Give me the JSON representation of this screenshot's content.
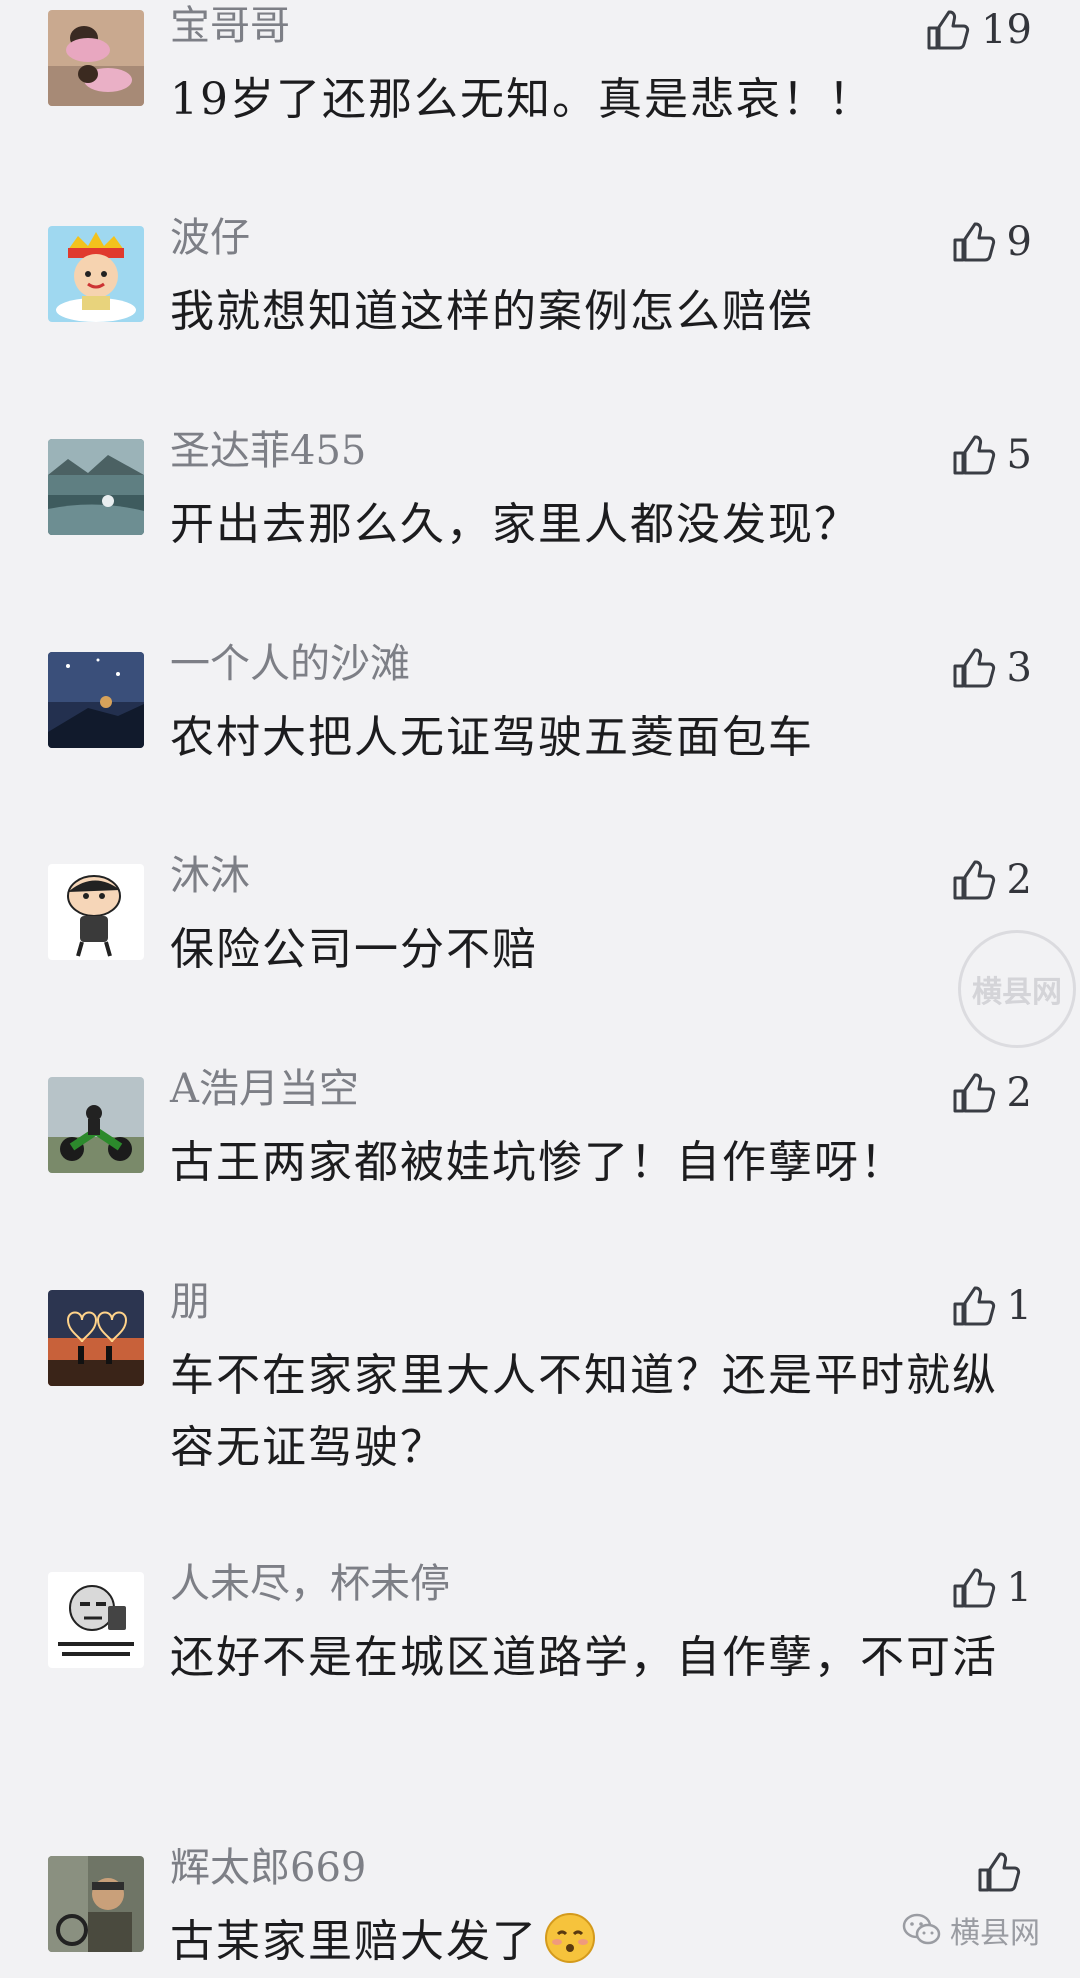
{
  "comments": [
    {
      "nickname": "宝哥哥",
      "content": "19岁了还那么无知。真是悲哀！！",
      "likes": "19",
      "avatar": "kids-photo-avatar"
    },
    {
      "nickname": "波仔",
      "content": "我就想知道这样的案例怎么赔偿",
      "likes": "9",
      "avatar": "cartoon-boy-avatar"
    },
    {
      "nickname": "圣达菲455",
      "content": "开出去那么久，家里人都没发现？",
      "likes": "5",
      "avatar": "landscape-avatar"
    },
    {
      "nickname": "一个人的沙滩",
      "content": "农村大把人无证驾驶五菱面包车",
      "likes": "3",
      "avatar": "night-sky-avatar"
    },
    {
      "nickname": "沐沐",
      "content": "保险公司一分不赔",
      "likes": "2",
      "avatar": "cartoon-character-avatar"
    },
    {
      "nickname": "A浩月当空",
      "content": "古王两家都被娃坑惨了！自作孽呀！",
      "likes": "2",
      "avatar": "motorcycle-avatar"
    },
    {
      "nickname": "朋",
      "content": "车不在家家里大人不知道？还是平时就纵容无证驾驶？",
      "likes": "1",
      "avatar": "sunset-hearts-avatar"
    },
    {
      "nickname": "人未尽，杯未停",
      "content": "还好不是在城区道路学，自作孽，不可活",
      "likes": "1",
      "avatar": "meme-avatar"
    },
    {
      "nickname": "辉太郎669",
      "content": "古某家里赔大发了",
      "likes": "",
      "avatar": "driver-avatar",
      "emoji": "smirk-emoji-icon"
    }
  ],
  "watermark": {
    "seal_text": "横县网"
  },
  "brand": {
    "name": "横县网",
    "icon": "wechat-icon"
  },
  "colors": {
    "background": "#f2f2f4",
    "nickname": "#7d7f86",
    "content": "#1c1c1e",
    "like_icon": "#3a3d44"
  }
}
